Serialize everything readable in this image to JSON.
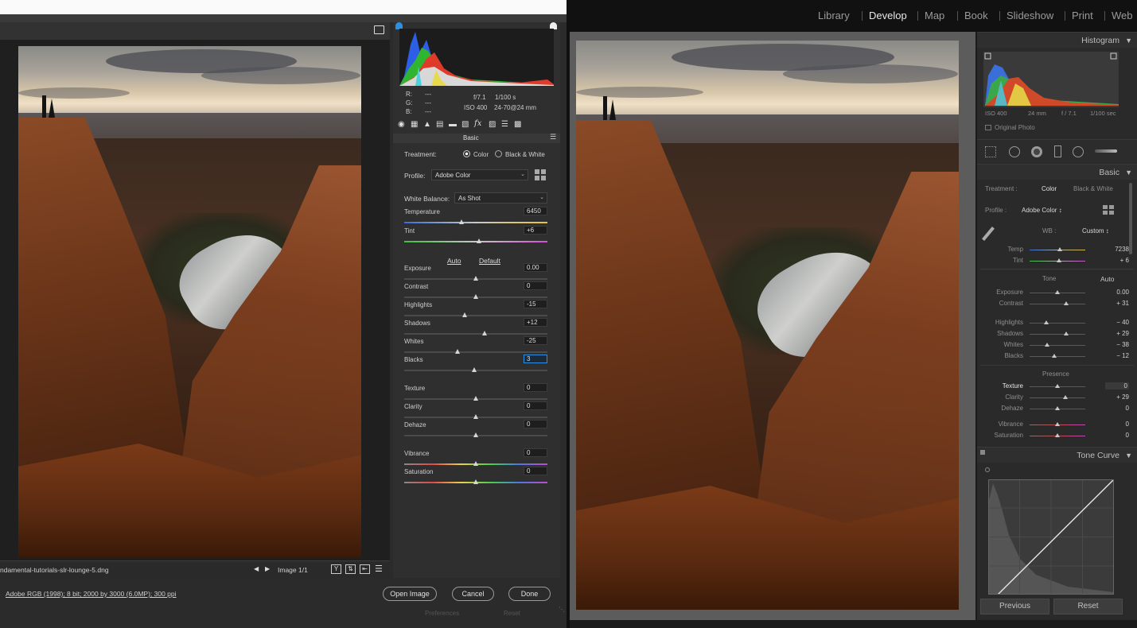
{
  "acr": {
    "filename": "ndamental-tutorials-slr-lounge-5.dng",
    "image_counter": "Image 1/1",
    "workflow": "Adobe RGB (1998); 8 bit; 2000 by 3000 (6.0MP); 300 ppi",
    "buttons": {
      "open": "Open Image",
      "cancel": "Cancel",
      "done": "Done"
    },
    "bottom_ghost": {
      "a": "Preferences",
      "b": "Reset"
    },
    "readout": {
      "r": "R:",
      "g": "G:",
      "b": "B:",
      "dash": "---",
      "aperture": "f/7.1",
      "shutter": "1/100 s",
      "iso": "ISO 400",
      "lens": "24-70@24 mm"
    },
    "panel_title": "Basic",
    "treatment_label": "Treatment:",
    "treatment_color": "Color",
    "treatment_bw": "Black & White",
    "profile_label": "Profile:",
    "profile_value": "Adobe Color",
    "wb_label": "White Balance:",
    "wb_value": "As Shot",
    "auto": "Auto",
    "default": "Default",
    "sliders": [
      {
        "label": "Temperature",
        "value": "6450",
        "pos": 0.4
      },
      {
        "label": "Tint",
        "value": "+6",
        "pos": 0.52
      },
      {
        "label": "Exposure",
        "value": "0.00",
        "pos": 0.5
      },
      {
        "label": "Contrast",
        "value": "0",
        "pos": 0.5
      },
      {
        "label": "Highlights",
        "value": "-15",
        "pos": 0.42
      },
      {
        "label": "Shadows",
        "value": "+12",
        "pos": 0.56
      },
      {
        "label": "Whites",
        "value": "-25",
        "pos": 0.37
      },
      {
        "label": "Blacks",
        "value": "3",
        "pos": 0.49
      },
      {
        "label": "Texture",
        "value": "0",
        "pos": 0.5
      },
      {
        "label": "Clarity",
        "value": "0",
        "pos": 0.5
      },
      {
        "label": "Dehaze",
        "value": "0",
        "pos": 0.5
      },
      {
        "label": "Vibrance",
        "value": "0",
        "pos": 0.5
      },
      {
        "label": "Saturation",
        "value": "0",
        "pos": 0.5
      }
    ]
  },
  "lr": {
    "modules": [
      "Library",
      "Develop",
      "Map",
      "Book",
      "Slideshow",
      "Print",
      "Web"
    ],
    "active_module": "Develop",
    "histogram_title": "Histogram",
    "hist_info": {
      "iso": "ISO 400",
      "lens": "24 mm",
      "aperture": "f / 7.1",
      "shutter": "1/100 sec"
    },
    "original_photo": "Original Photo",
    "basic_title": "Basic",
    "treatment_label": "Treatment :",
    "treatment_color": "Color",
    "treatment_bw": "Black & White",
    "profile_label": "Profile :",
    "profile_value": "Adobe Color ↕",
    "wb_label": "WB :",
    "wb_value": "Custom ↕",
    "tone_label": "Tone",
    "tone_auto": "Auto",
    "presence_label": "Presence",
    "sliders": [
      {
        "label": "Temp",
        "value": "7238",
        "pos": 0.54
      },
      {
        "label": "Tint",
        "value": "+ 6",
        "pos": 0.53
      },
      {
        "label": "Exposure",
        "value": "0.00",
        "pos": 0.5
      },
      {
        "label": "Contrast",
        "value": "+ 31",
        "pos": 0.65
      },
      {
        "label": "Highlights",
        "value": "− 40",
        "pos": 0.3
      },
      {
        "label": "Shadows",
        "value": "+ 29",
        "pos": 0.65
      },
      {
        "label": "Whites",
        "value": "− 38",
        "pos": 0.31
      },
      {
        "label": "Blacks",
        "value": "− 12",
        "pos": 0.44
      },
      {
        "label": "Texture",
        "value": "0",
        "pos": 0.5
      },
      {
        "label": "Clarity",
        "value": "+ 29",
        "pos": 0.64
      },
      {
        "label": "Dehaze",
        "value": "0",
        "pos": 0.5
      },
      {
        "label": "Vibrance",
        "value": "0",
        "pos": 0.5
      },
      {
        "label": "Saturation",
        "value": "0",
        "pos": 0.5
      }
    ],
    "tone_curve_title": "Tone Curve",
    "buttons": {
      "previous": "Previous",
      "reset": "Reset"
    }
  },
  "colors": {
    "acr_panel": "#2f2f2f",
    "lr_panel": "#2a2a2a",
    "accent_blue": "#2d8fe0"
  }
}
